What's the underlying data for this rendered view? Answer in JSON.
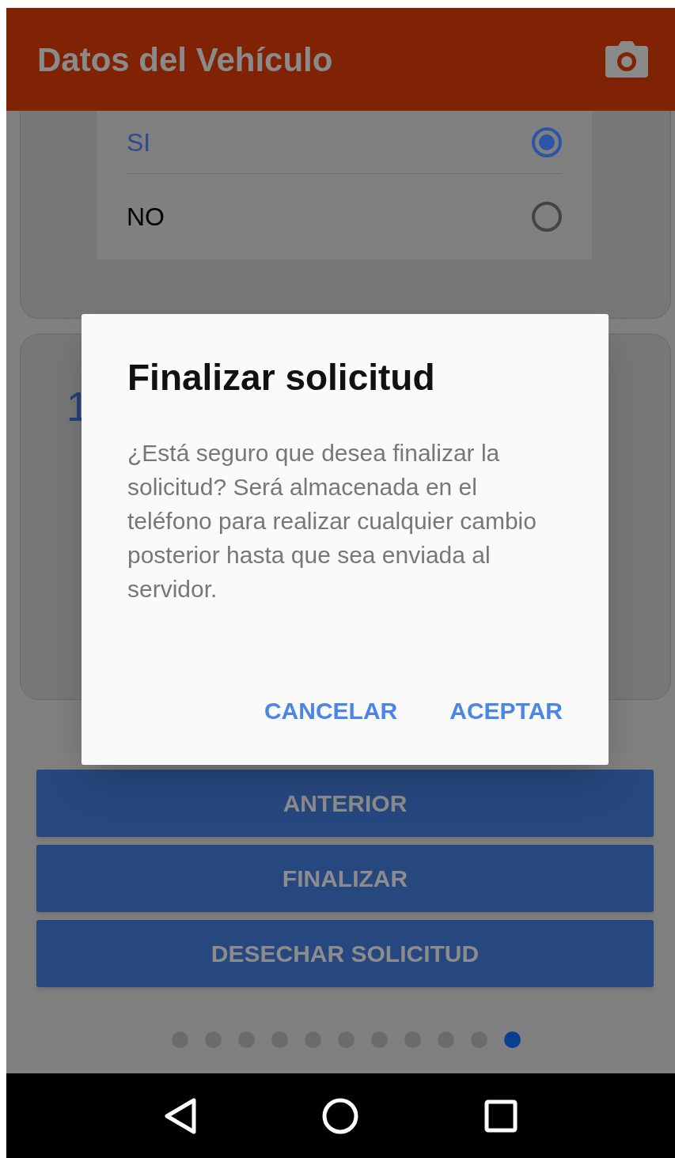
{
  "app_bar": {
    "title": "Datos del Vehículo"
  },
  "options": [
    {
      "label": "SI",
      "selected": true
    },
    {
      "label": "NO",
      "selected": false
    }
  ],
  "card_number": "1",
  "buttons": [
    "ANTERIOR",
    "FINALIZAR",
    "DESECHAR SOLICITUD"
  ],
  "pager": [
    {
      "selected": false
    },
    {
      "selected": false
    },
    {
      "selected": false
    },
    {
      "selected": false
    },
    {
      "selected": false
    },
    {
      "selected": false
    },
    {
      "selected": false
    },
    {
      "selected": false
    },
    {
      "selected": false
    },
    {
      "selected": false
    },
    {
      "selected": true
    }
  ],
  "dialog": {
    "title": "Finalizar solicitud",
    "message": "¿Está seguro que desea finalizar la solicitud? Será almacenada en el teléfono para realizar cualquier cambio posterior hasta que sea enviada al servidor.",
    "actions": [
      "CANCELAR",
      "ACEPTAR"
    ]
  }
}
